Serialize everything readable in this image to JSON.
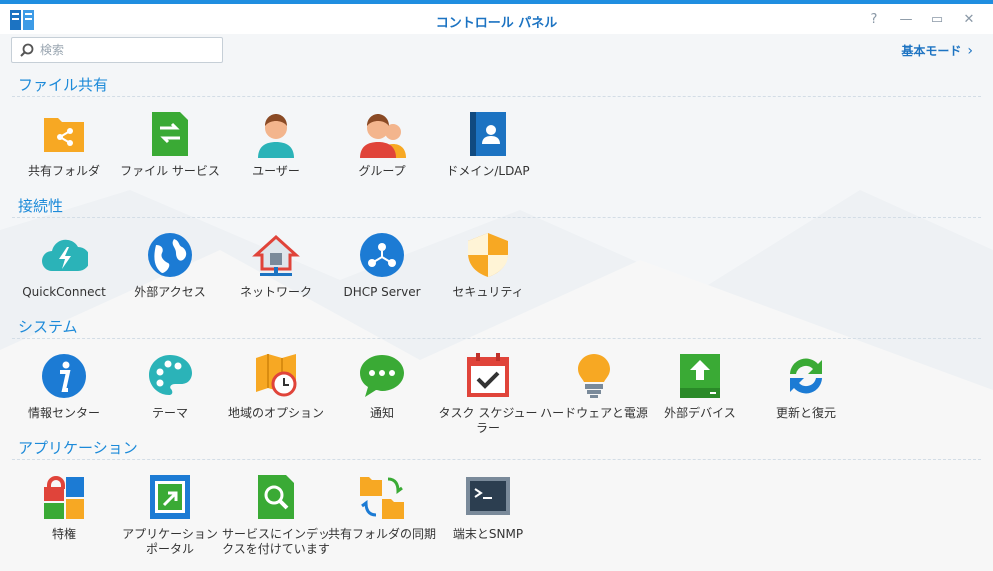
{
  "window": {
    "title": "コントロール パネル"
  },
  "search": {
    "placeholder": "検索"
  },
  "header": {
    "basic_mode": "基本モード"
  },
  "sections": [
    {
      "title": "ファイル共有",
      "items": [
        {
          "label": "共有フォルダ",
          "icon": "shared-folder-icon"
        },
        {
          "label": "ファイル サービス",
          "icon": "file-services-icon"
        },
        {
          "label": "ユーザー",
          "icon": "user-icon"
        },
        {
          "label": "グループ",
          "icon": "group-icon"
        },
        {
          "label": "ドメイン/LDAP",
          "icon": "domain-ldap-icon"
        }
      ]
    },
    {
      "title": "接続性",
      "items": [
        {
          "label": "QuickConnect",
          "icon": "quickconnect-icon"
        },
        {
          "label": "外部アクセス",
          "icon": "external-access-icon"
        },
        {
          "label": "ネットワーク",
          "icon": "network-icon"
        },
        {
          "label": "DHCP Server",
          "icon": "dhcp-server-icon"
        },
        {
          "label": "セキュリティ",
          "icon": "security-icon"
        }
      ]
    },
    {
      "title": "システム",
      "items": [
        {
          "label": "情報センター",
          "icon": "info-center-icon"
        },
        {
          "label": "テーマ",
          "icon": "theme-icon"
        },
        {
          "label": "地域のオプション",
          "icon": "regional-options-icon"
        },
        {
          "label": "通知",
          "icon": "notification-icon"
        },
        {
          "label": "タスク スケジューラー",
          "icon": "task-scheduler-icon"
        },
        {
          "label": "ハードウェアと電源",
          "icon": "hardware-power-icon"
        },
        {
          "label": "外部デバイス",
          "icon": "external-devices-icon"
        },
        {
          "label": "更新と復元",
          "icon": "update-restore-icon"
        }
      ]
    },
    {
      "title": "アプリケーション",
      "items": [
        {
          "label": "特権",
          "icon": "privileges-icon"
        },
        {
          "label": "アプリケーション ポータル",
          "icon": "application-portal-icon"
        },
        {
          "label": "サービスにインデックスを付けています",
          "icon": "indexing-service-icon"
        },
        {
          "label": "共有フォルダの同期",
          "icon": "shared-folder-sync-icon"
        },
        {
          "label": "端末とSNMP",
          "icon": "terminal-snmp-icon"
        }
      ]
    }
  ]
}
